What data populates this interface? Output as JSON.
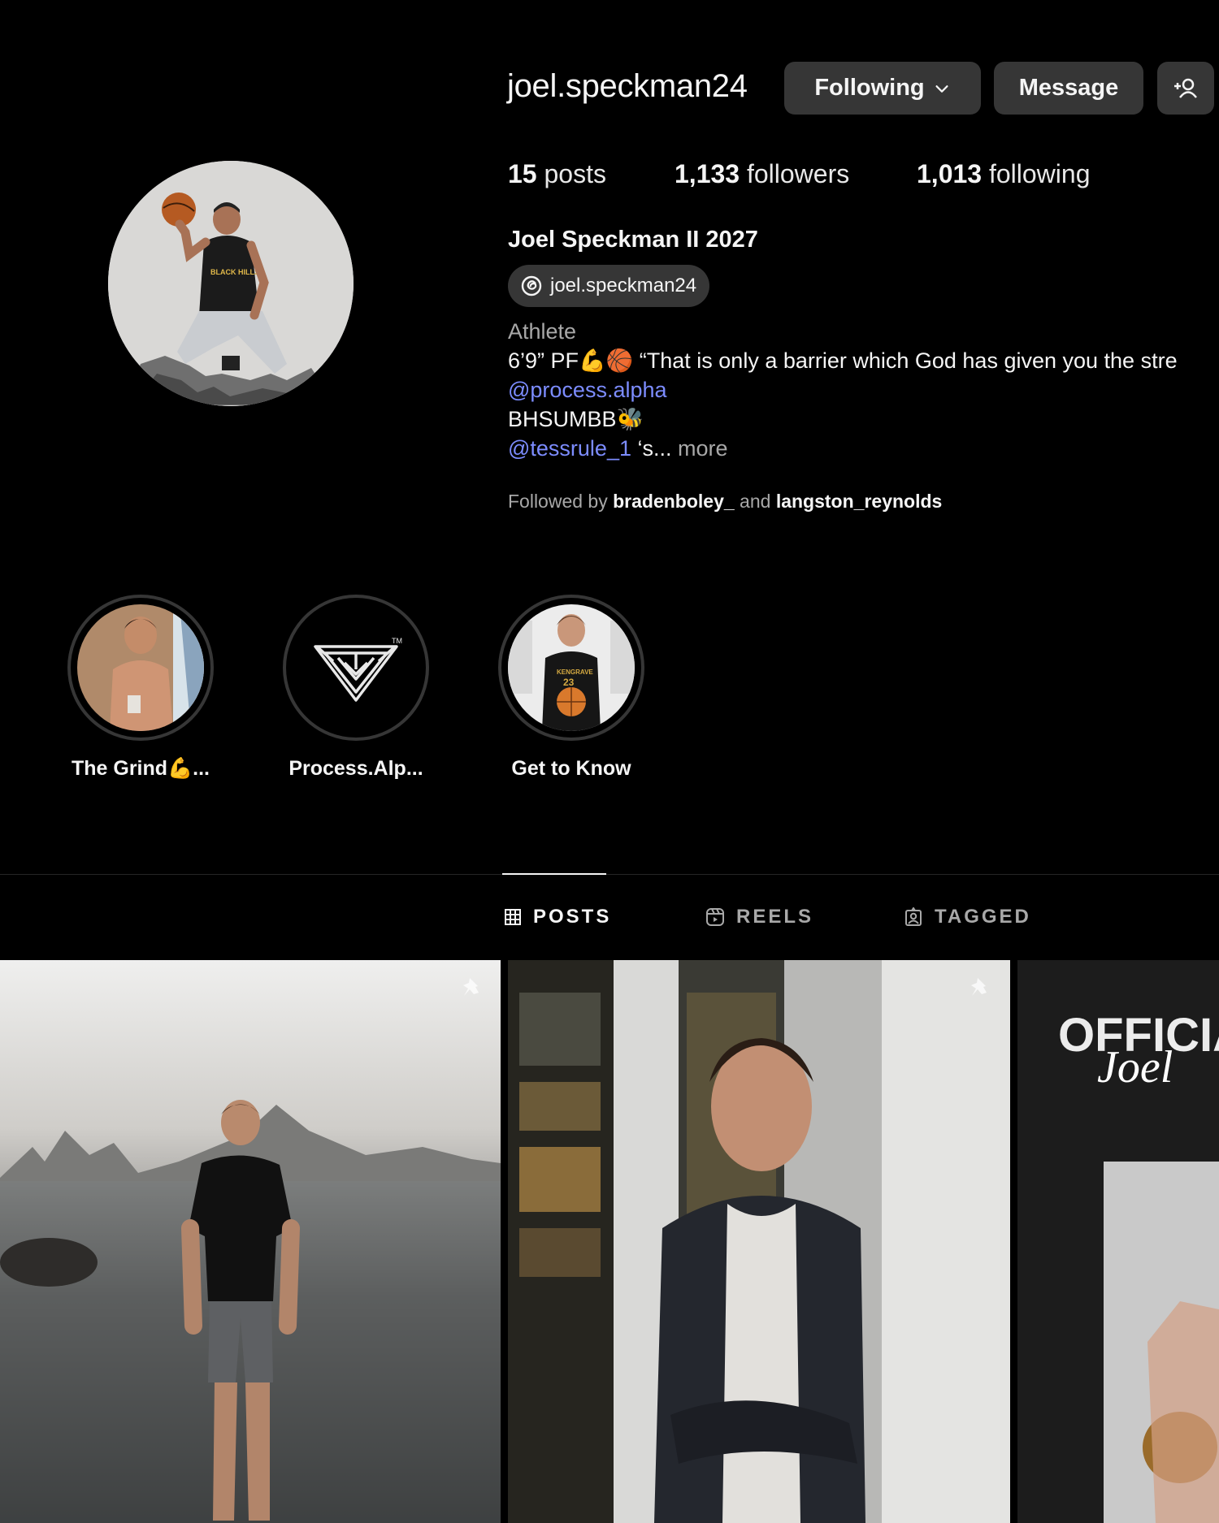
{
  "profile": {
    "username": "joel.speckman24",
    "following_btn": "Following",
    "message_btn": "Message",
    "stats": {
      "posts_count": "15",
      "posts_label": "posts",
      "followers_count": "1,133",
      "followers_label": "followers",
      "following_count": "1,013",
      "following_label": "following"
    },
    "full_name": "Joel Speckman II 2027",
    "threads_handle": "joel.speckman24",
    "bio": {
      "category": "Athlete",
      "line1": "6’9” PF💪🏀 “That is only a barrier which God has given you the stre",
      "mention1": "@process.alpha",
      "line3": "BHSUMBB🐝",
      "mention2": "@tessrule_1",
      "line4_suffix": " ‘s...",
      "more": " more"
    },
    "followed_by": {
      "prefix": "Followed by ",
      "user1": "bradenboley_",
      "conj": " and ",
      "user2": "langston_reynolds"
    }
  },
  "highlights": [
    {
      "label": "The Grind💪..."
    },
    {
      "label": "Process.Alp..."
    },
    {
      "label": "Get to Know"
    }
  ],
  "tabs": [
    {
      "label": "POSTS"
    },
    {
      "label": "REELS"
    },
    {
      "label": "TAGGED"
    }
  ],
  "posts": {
    "tile3_text1": "OFFICIA",
    "tile3_text2": "Joel"
  },
  "colors": {
    "background": "#000000",
    "button": "#363636",
    "link": "#7c8cff",
    "muted": "#a8a8a8"
  }
}
